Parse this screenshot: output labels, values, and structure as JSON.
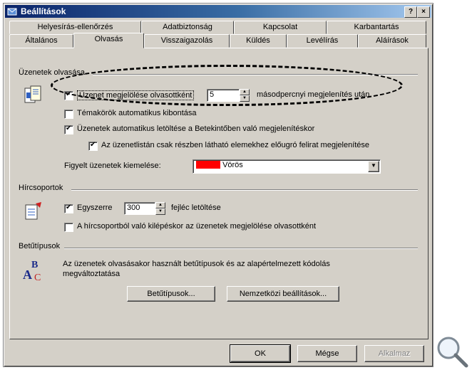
{
  "window": {
    "title": "Beállítások",
    "help_label": "?",
    "close_label": "×"
  },
  "tabs_back": [
    "Helyesírás-ellenőrzés",
    "Adatbiztonság",
    "Kapcsolat",
    "Karbantartás"
  ],
  "tabs_front": [
    "Általános",
    "Olvasás",
    "Visszaigazolás",
    "Küldés",
    "Levélírás",
    "Aláírások"
  ],
  "sections": {
    "reading": {
      "title": "Üzenetek olvasása",
      "mark_read": {
        "label": "Üzenet megjelölése olvasottként",
        "checked": true,
        "value": "5",
        "suffix": "másodpercnyi megjelenítés után"
      },
      "auto_expand": {
        "label": "Témakörök automatikus kibontása",
        "checked": false
      },
      "auto_download": {
        "label": "Üzenetek automatikus letöltése a Betekintőben való megjelenítéskor",
        "checked": true
      },
      "tooltips": {
        "label": "Az üzenetlistán csak részben látható elemekhez előugró felirat megjelenítése",
        "checked": true
      },
      "highlight": {
        "label": "Figyelt üzenetek kiemelése:",
        "value": "Vörös",
        "color": "#ff0000"
      }
    },
    "news": {
      "title": "Hírcsoportok",
      "header_count": {
        "label": "Egyszerre",
        "checked": true,
        "value": "300",
        "suffix": "fejléc letöltése"
      },
      "mark_on_exit": {
        "label": "A hírcsoportból való kilépéskor az üzenetek megjelölése olvasottként",
        "checked": false
      }
    },
    "fonts": {
      "title": "Betűtípusok",
      "description": "Az üzenetek olvasásakor használt betűtípusok és az alapértelmezett kódolás megváltoztatása",
      "fonts_button": "Betűtípusok...",
      "intl_button": "Nemzetközi beállítások..."
    }
  },
  "footer": {
    "ok": "OK",
    "cancel": "Mégse",
    "apply": "Alkalmaz"
  },
  "icons": {
    "title": "outlook-express-icon",
    "zoom": "magnifier-icon"
  }
}
